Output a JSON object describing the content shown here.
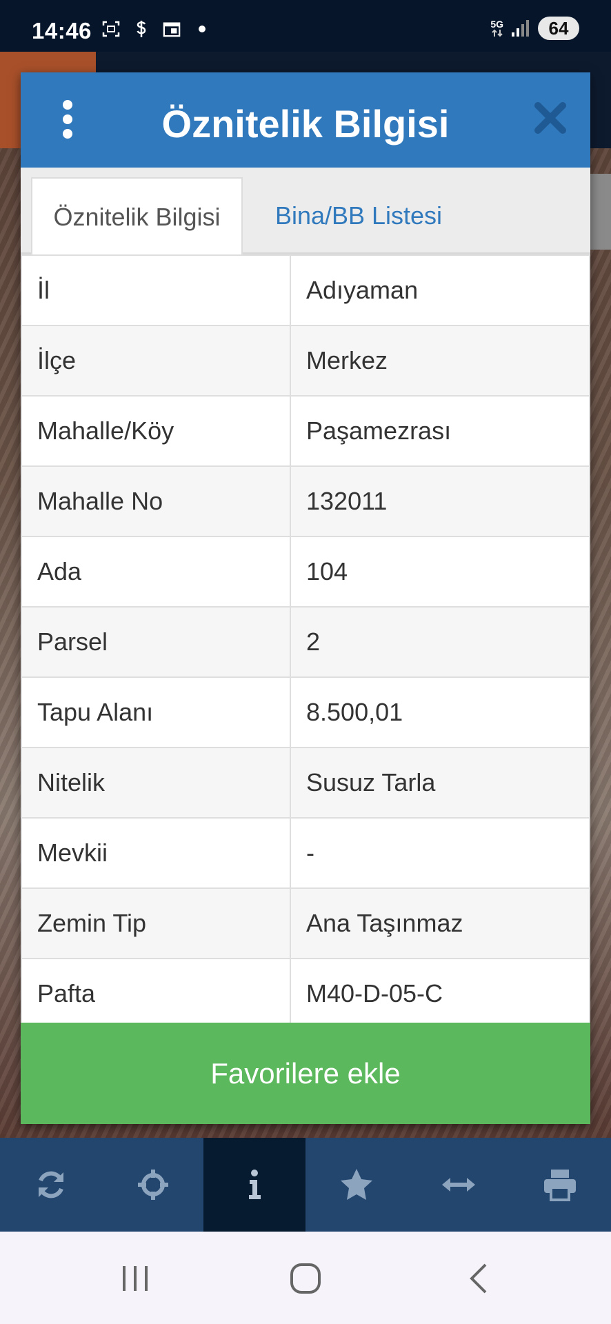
{
  "status_bar": {
    "time": "14:46",
    "network": "5G",
    "battery": "64",
    "icons": [
      "screenshot-icon",
      "dollar-icon",
      "calendar-icon",
      "notification-dot-icon"
    ]
  },
  "dialog": {
    "title": "Öznitelik Bilgisi",
    "tabs": [
      {
        "label": "Öznitelik Bilgisi",
        "active": true
      },
      {
        "label": "Bina/BB Listesi",
        "active": false
      }
    ],
    "rows": [
      {
        "key": "İl",
        "value": "Adıyaman"
      },
      {
        "key": "İlçe",
        "value": "Merkez"
      },
      {
        "key": "Mahalle/Köy",
        "value": "Paşamezrası"
      },
      {
        "key": "Mahalle No",
        "value": "132011"
      },
      {
        "key": "Ada",
        "value": "104"
      },
      {
        "key": "Parsel",
        "value": "2"
      },
      {
        "key": "Tapu Alanı",
        "value": "8.500,01"
      },
      {
        "key": "Nitelik",
        "value": "Susuz Tarla"
      },
      {
        "key": "Mevkii",
        "value": "-"
      },
      {
        "key": "Zemin Tip",
        "value": "Ana Taşınmaz"
      },
      {
        "key": "Pafta",
        "value": "M40-D-05-C"
      }
    ],
    "favorite_button_label": "Favorilere ekle"
  },
  "toolbar": {
    "items": [
      "refresh-icon",
      "locate-icon",
      "info-icon",
      "star-icon",
      "measure-icon",
      "print-icon"
    ],
    "active": "info-icon"
  },
  "colors": {
    "header": "#3079bd",
    "favorite_button": "#5cb85c",
    "toolbar": "#23466f",
    "toolbar_active": "#061a30"
  }
}
